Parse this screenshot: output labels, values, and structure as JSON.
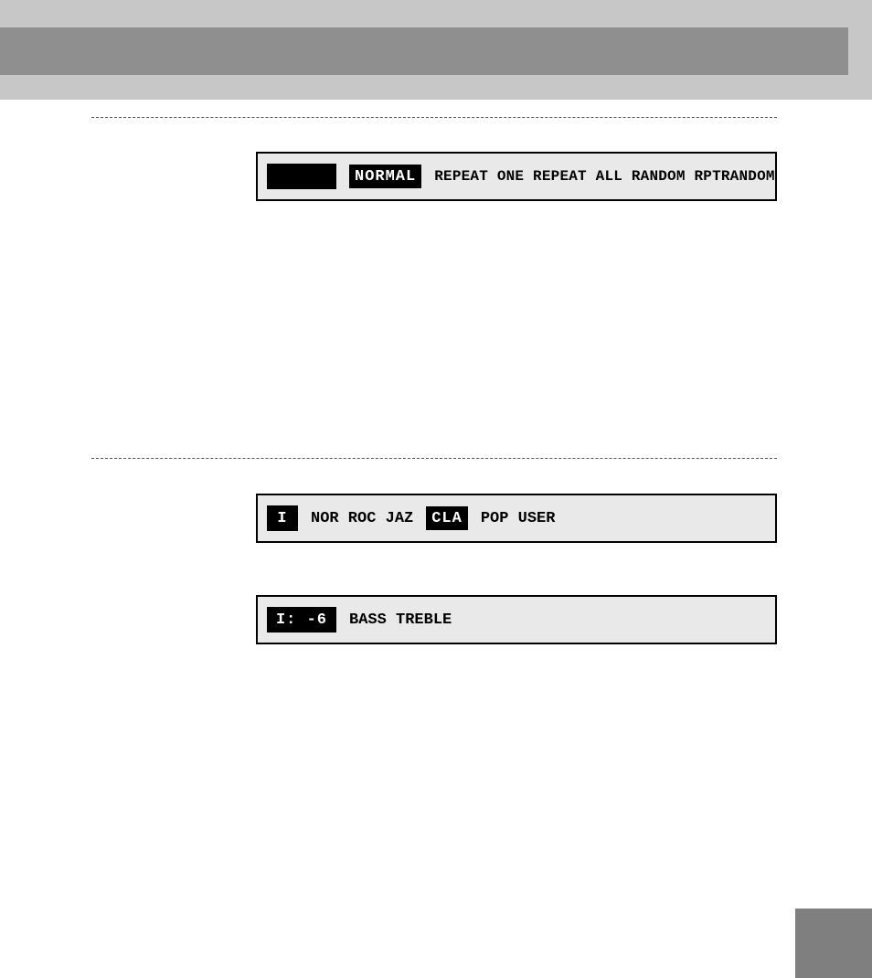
{
  "lcd_repeat": {
    "tag": "",
    "selected": "NORMAL",
    "rest": "REPEAT ONE  REPEAT ALL  RANDOM  RPTRANDOM"
  },
  "lcd_eq": {
    "tag": "I",
    "left": "NOR ROC JAZ",
    "selected": "CLA",
    "right": "POP USER"
  },
  "lcd_tone": {
    "tag": "I: -6",
    "items": "BASS   TREBLE"
  }
}
